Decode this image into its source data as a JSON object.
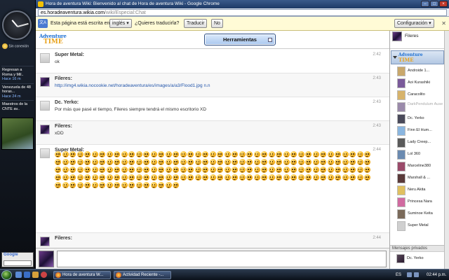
{
  "sidebar": {
    "weather_text": "Sin conexión",
    "feed": [
      {
        "text": "Regresan a Roma y Mil..",
        "time": "Hace 16 m"
      },
      {
        "text": "Venezuela de 48 horas...",
        "time": "Hace 24 m"
      },
      {
        "text": "Maestros de la CNTE av..",
        "time": ""
      }
    ],
    "google_label": "Google"
  },
  "window": {
    "title": "Hora de aventura Wiki: Bienvenido al chat de Hora de aventura Wiki - Google Chrome",
    "url_domain": "es.horadeaventura.wikia.com",
    "url_path": "/wiki/Especial:Chat"
  },
  "translate": {
    "prompt": "Esta página está escrita en",
    "language": "inglés",
    "question": "¿Quieres traducirla?",
    "translate_btn": "Traducir",
    "no_btn": "No",
    "config_btn": "Configuración"
  },
  "chat": {
    "logo_line1": "Adventure",
    "logo_line2": "TIME",
    "tools_label": "Herramientas",
    "messages": [
      {
        "user": "Super Metal:",
        "text": "ok",
        "time": "2:42",
        "avatar": "gray"
      },
      {
        "user": "Fileres:",
        "text": "http://img4.wikia.nocookie.net/horadeaventura/es/images/a/a3/Flood1.jpg n.n",
        "time": "2:43",
        "avatar": "pic",
        "link": true
      },
      {
        "user": "Dc. Yerko:",
        "text": "Por más que pasé el tiempo, Fileres siempre tendrá el mismo escritorio XD",
        "time": "2:43",
        "avatar": "gray"
      },
      {
        "user": "Fileres:",
        "text": "xDD",
        "time": "2:43",
        "avatar": "pic"
      },
      {
        "user": "Super Metal:",
        "text": "",
        "time": "2:44",
        "avatar": "gray",
        "smileys": 189
      },
      {
        "user": "Fileres:",
        "text": "",
        "time": "2:44",
        "avatar": "pic"
      }
    ]
  },
  "users": {
    "self_name": "Fileres",
    "room_line1": "Adventure",
    "room_line2": "TIME",
    "list": [
      {
        "name": "Androide 1...",
        "away": false,
        "color": "#c9a86b"
      },
      {
        "name": "Aoi Kurashiki",
        "away": false,
        "color": "#7a5a9a"
      },
      {
        "name": "Caracolito",
        "away": false,
        "color": "#d7b36b"
      },
      {
        "name": "DarkPendulum Ausente",
        "away": true,
        "color": "#9a8aaa"
      },
      {
        "name": "Dc. Yerko",
        "away": false,
        "color": "#4a4a5a"
      },
      {
        "name": "Finn El Hum...",
        "away": false,
        "color": "#8ab6e0"
      },
      {
        "name": "Lady Creep...",
        "away": false,
        "color": "#5a5a5a"
      },
      {
        "name": "Lol 360",
        "away": false,
        "color": "#6a8ab0"
      },
      {
        "name": "Marceline380",
        "away": false,
        "color": "#9a4a6a"
      },
      {
        "name": "Marshall & ...",
        "away": false,
        "color": "#5a3a3a"
      },
      {
        "name": "Neru Akita",
        "away": false,
        "color": "#e0c060"
      },
      {
        "name": "Princesa Nara",
        "away": false,
        "color": "#d06aa0"
      },
      {
        "name": "Suminoe Keita",
        "away": false,
        "color": "#7a6a5a"
      },
      {
        "name": "Super Metal",
        "away": false,
        "color": "#cfcfcf"
      }
    ],
    "pm_header": "Mensajes privados",
    "pm": [
      {
        "name": "Dc. Yerko"
      }
    ]
  },
  "taskbar": {
    "items": [
      {
        "label": "Hora de aventura W..."
      },
      {
        "label": "Actividad Reciente -..."
      }
    ],
    "lang": "ES",
    "clock": "02:44 p.m."
  }
}
